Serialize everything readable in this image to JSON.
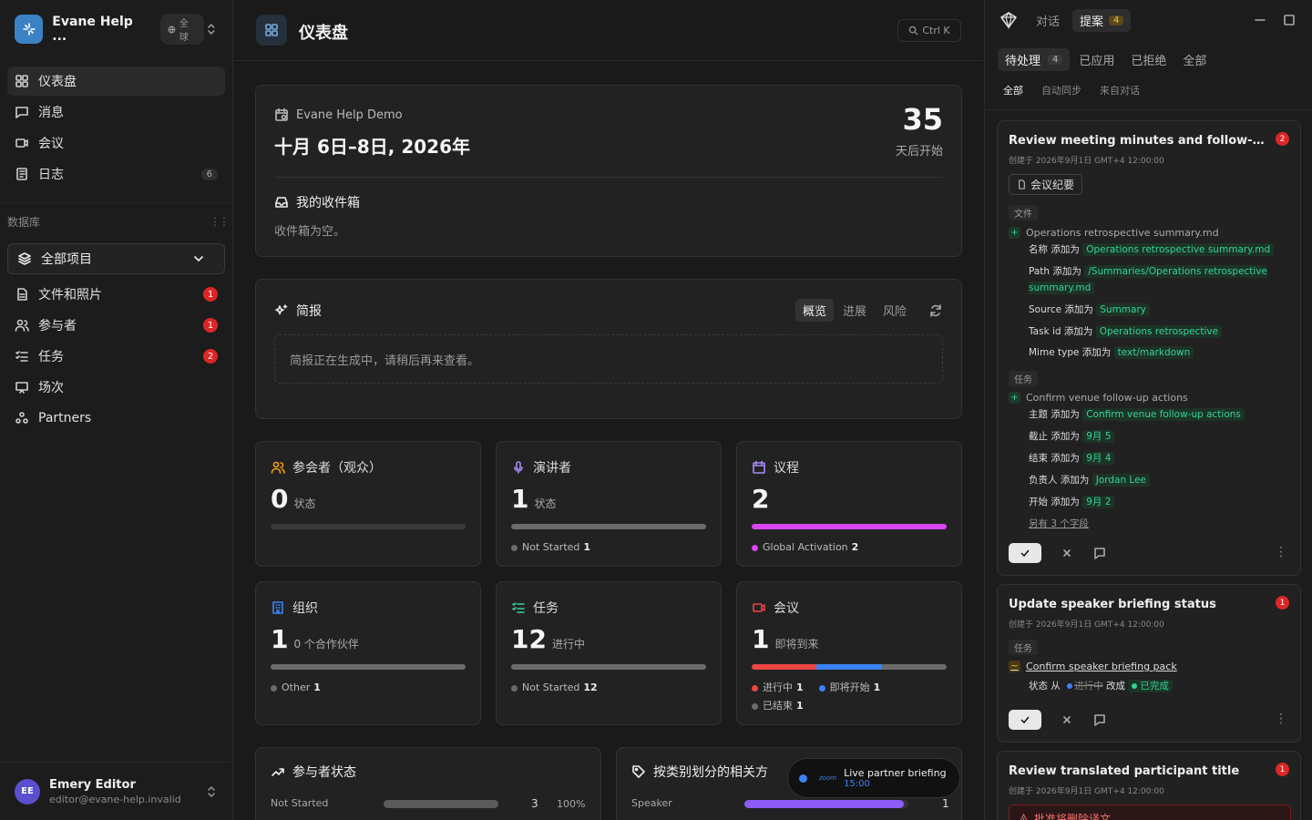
{
  "sidebar": {
    "workspace_name": "Evane Help ...",
    "workspace_badge": "全球",
    "nav": [
      {
        "label": "仪表盘"
      },
      {
        "label": "消息"
      },
      {
        "label": "会议"
      },
      {
        "label": "日志",
        "count": "6"
      }
    ],
    "section_label": "数据库",
    "project_select": "全部项目",
    "db_items": [
      {
        "label": "文件和照片",
        "badge": "1"
      },
      {
        "label": "参与者",
        "badge": "1"
      },
      {
        "label": "任务",
        "badge": "2"
      },
      {
        "label": "场次"
      },
      {
        "label": "Partners"
      }
    ],
    "user": {
      "initials": "EE",
      "name": "Emery Editor",
      "email": "editor@evane-help.invalid"
    }
  },
  "main": {
    "title": "仪表盘",
    "search_shortcut": "Ctrl K",
    "event": {
      "name": "Evane Help Demo",
      "dates": "十月 6日–8日, 2026年",
      "days": "35",
      "days_label": "天后开始"
    },
    "inbox": {
      "title": "我的收件箱",
      "empty": "收件箱为空。"
    },
    "brief": {
      "title": "简报",
      "tabs": [
        "概览",
        "进展",
        "风险"
      ],
      "message": "简报正在生成中，请稍后再来查看。"
    },
    "stats": {
      "attendees": {
        "title": "参会者（观众）",
        "value": "0",
        "unit": "状态"
      },
      "speakers": {
        "title": "演讲者",
        "value": "1",
        "unit": "状态",
        "legend": [
          {
            "label": "Not Started",
            "count": "1",
            "color": "#6b6b6b"
          }
        ]
      },
      "agenda": {
        "title": "议程",
        "value": "2",
        "legend": [
          {
            "label": "Global Activation",
            "count": "2",
            "color": "#d946ef"
          }
        ]
      },
      "orgs": {
        "title": "组织",
        "value": "1",
        "unit": "0 个合作伙伴",
        "legend": [
          {
            "label": "Other",
            "count": "1",
            "color": "#6b6b6b"
          }
        ]
      },
      "tasks": {
        "title": "任务",
        "value": "12",
        "unit": "进行中",
        "legend": [
          {
            "label": "Not Started",
            "count": "12",
            "color": "#6b6b6b"
          }
        ]
      },
      "meetings": {
        "title": "会议",
        "value": "1",
        "unit": "即将到来",
        "legend": [
          {
            "label": "进行中",
            "count": "1",
            "color": "#ef4444"
          },
          {
            "label": "即将开始",
            "count": "1",
            "color": "#3b82f6"
          },
          {
            "label": "已结束",
            "count": "1",
            "color": "#6b6b6b"
          }
        ]
      }
    },
    "participant_status": {
      "title": "参与者状态",
      "row_label": "Not Started",
      "count": "3",
      "pct": "100%",
      "fraction": 1.0
    },
    "related": {
      "title": "按类别划分的相关方",
      "row_label": "Speaker",
      "count": "1",
      "fraction": 0.97
    },
    "live": {
      "title": "Live partner briefing",
      "time": "15:00",
      "brand": "zoom"
    }
  },
  "panel": {
    "tabs": [
      {
        "label": "对话"
      },
      {
        "label": "提案",
        "count": "4"
      }
    ],
    "filters": [
      {
        "label": "待处理",
        "count": "4"
      },
      {
        "label": "已应用"
      },
      {
        "label": "已拒绝"
      },
      {
        "label": "全部"
      }
    ],
    "subfilters": [
      "全部",
      "自动同步",
      "来自对话"
    ],
    "proposals": [
      {
        "title": "Review meeting minutes and follow-up t...",
        "count": "2",
        "created": "创建于 2026年9月1日 GMT+4 12:00:00",
        "chip": "会议纪要",
        "group1": "文件",
        "rec1": "Operations retrospective summary.md",
        "fields1": [
          {
            "k": "名称 添加为",
            "v": "Operations retrospective summary.md"
          },
          {
            "k": "Path 添加为",
            "v": "/Summaries/Operations retrospective summary.md"
          },
          {
            "k": "Source 添加为",
            "v": "Summary"
          },
          {
            "k": "Task id 添加为",
            "v": "Operations retrospective"
          },
          {
            "k": "Mime type 添加为",
            "v": "text/markdown"
          }
        ],
        "group2": "任务",
        "rec2": "Confirm venue follow-up actions",
        "fields2": [
          {
            "k": "主题 添加为",
            "v": "Confirm venue follow-up actions"
          },
          {
            "k": "截止 添加为",
            "v": "9月 5"
          },
          {
            "k": "结束 添加为",
            "v": "9月 4"
          },
          {
            "k": "负责人 添加为",
            "v": "Jordan Lee"
          },
          {
            "k": "开始 添加为",
            "v": "9月 2"
          }
        ],
        "more": "另有 3 个字段"
      },
      {
        "title": "Update speaker briefing status",
        "count": "1",
        "created": "创建于 2026年9月1日 GMT+4 12:00:00",
        "group": "任务",
        "rec": "Confirm speaker briefing pack",
        "change_prefix": "状态 从",
        "from": "进行中",
        "change_mid": "改成",
        "to": "已完成"
      },
      {
        "title": "Review translated participant title",
        "count": "1",
        "created": "创建于 2026年9月1日 GMT+4 12:00:00",
        "warning": "批准将删除译文"
      }
    ]
  }
}
